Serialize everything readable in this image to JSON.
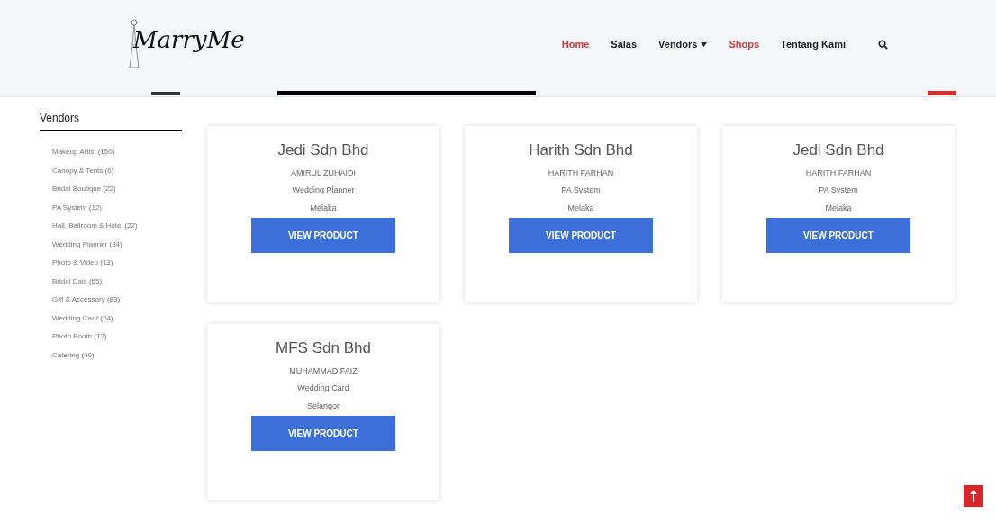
{
  "header": {
    "logo": "MarryMe",
    "nav": [
      {
        "label": "Home",
        "selected": true,
        "dropdown": false
      },
      {
        "label": "Salas",
        "selected": false,
        "dropdown": false
      },
      {
        "label": "Vendors",
        "selected": false,
        "dropdown": true
      },
      {
        "label": "Shops",
        "selected": true,
        "dropdown": false
      },
      {
        "label": "Tentang Kami",
        "selected": false,
        "dropdown": false
      }
    ]
  },
  "sidebar": {
    "title": "Vendors",
    "items": [
      {
        "label": "Makeup Artist",
        "count": "(150)"
      },
      {
        "label": "Canopy & Tents",
        "count": "(6)"
      },
      {
        "label": "Bridal Boutique",
        "count": "(22)"
      },
      {
        "label": "PA System",
        "count": "(12)"
      },
      {
        "label": "Hall, Ballroom & Hotel",
        "count": "(22)"
      },
      {
        "label": "Wedding Planner",
        "count": "(34)"
      },
      {
        "label": "Photo & Video",
        "count": "(13)"
      },
      {
        "label": "Bridal Dais",
        "count": "(65)"
      },
      {
        "label": "Gift & Accessory",
        "count": "(83)"
      },
      {
        "label": "Wedding Card",
        "count": "(24)"
      },
      {
        "label": "Photo Booth",
        "count": "(12)"
      },
      {
        "label": "Catering",
        "count": "(40)"
      }
    ]
  },
  "shops": [
    {
      "name": "Jedi Sdn Bhd",
      "owner": "AMIRUL ZUHAIDI",
      "category": "Wedding Planner",
      "location": "Melaka",
      "button": "VIEW PRODUCT"
    },
    {
      "name": "Harith Sdn Bhd",
      "owner": "HARITH FARHAN",
      "category": "PA System",
      "location": "Melaka",
      "button": "VIEW PRODUCT"
    },
    {
      "name": "Jedi Sdn Bhd",
      "owner": "HARITH FARHAN",
      "category": "PA System",
      "location": "Melaka",
      "button": "VIEW PRODUCT"
    },
    {
      "name": "MFS Sdn Bhd",
      "owner": "MUHAMMAD FAIZ",
      "category": "Wedding Card",
      "location": "Selangor",
      "button": "VIEW PRODUCT"
    }
  ]
}
